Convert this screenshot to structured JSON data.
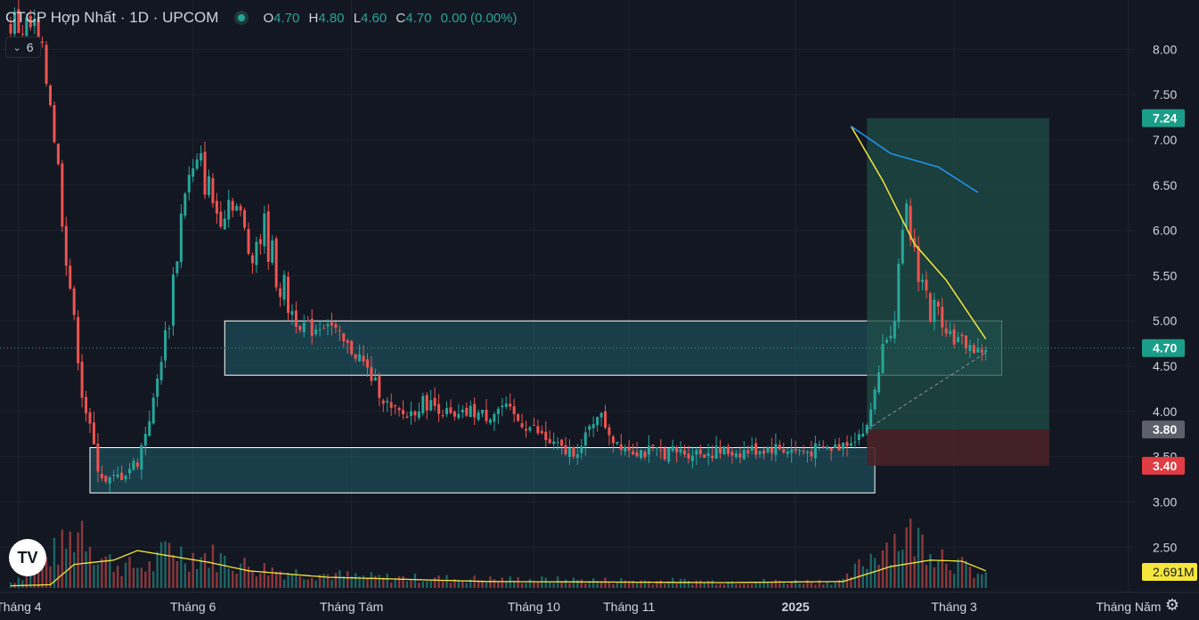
{
  "header": {
    "title": "CTCP Hợp Nhất · 1D · UPCOM",
    "ohlc": [
      {
        "key": "O",
        "value": "4.70"
      },
      {
        "key": "H",
        "value": "4.80"
      },
      {
        "key": "L",
        "value": "4.60"
      },
      {
        "key": "C",
        "value": "4.70"
      }
    ],
    "change": "0.00 (0.00%)",
    "indicator_count": "6",
    "status_icon": "market-open-dot-icon",
    "collapse_icon": "chevron-down-icon",
    "logo_text": "TV",
    "settings_icon": "gear-icon"
  },
  "colors": {
    "background": "#131722",
    "up": "#26a69a",
    "down": "#ef5350",
    "ma_fast": "#f5e63b",
    "ma_slow": "#2196f3",
    "zone_fill": "#1f5f6b",
    "target_fill": "#1f4d45",
    "stop_fill": "#4a2228"
  },
  "chart_data": {
    "type": "candlestick",
    "title": "CTCP Hợp Nhất · 1D · UPCOM",
    "y_ticks": [
      "8.00",
      "7.50",
      "7.00",
      "6.50",
      "6.00",
      "5.50",
      "5.00",
      "4.50",
      "4.00",
      "3.50",
      "3.00",
      "2.50"
    ],
    "y_range": [
      2.05,
      8.25
    ],
    "x_ticks": [
      "Tháng 4",
      "Tháng 6",
      "Tháng Tám",
      "Tháng 10",
      "Tháng 11",
      "2025",
      "Tháng 3",
      "Tháng Năm"
    ],
    "x_ticks_bold": [
      "2025"
    ],
    "candle_keypoints": [
      [
        0,
        8.3,
        "open"
      ],
      [
        6,
        8.2
      ],
      [
        10,
        7.5
      ],
      [
        14,
        5.8
      ],
      [
        18,
        4.2
      ],
      [
        22,
        3.4
      ],
      [
        24,
        3.2
      ],
      [
        28,
        3.3
      ],
      [
        32,
        3.45
      ],
      [
        36,
        4.1
      ],
      [
        40,
        5.1
      ],
      [
        44,
        6.5
      ],
      [
        48,
        6.7
      ],
      [
        52,
        6.2
      ],
      [
        56,
        6.4
      ],
      [
        60,
        5.8
      ],
      [
        64,
        6.0
      ],
      [
        68,
        5.4
      ],
      [
        72,
        5.0
      ],
      [
        76,
        4.9
      ],
      [
        80,
        5.0
      ],
      [
        84,
        4.75
      ],
      [
        88,
        4.6
      ],
      [
        92,
        4.3
      ],
      [
        96,
        4.0
      ],
      [
        100,
        3.95
      ],
      [
        104,
        4.1
      ],
      [
        108,
        4.05
      ],
      [
        112,
        3.9
      ],
      [
        116,
        4.0
      ],
      [
        120,
        3.95
      ],
      [
        124,
        4.05
      ],
      [
        128,
        3.9
      ],
      [
        132,
        3.8
      ],
      [
        136,
        3.65
      ],
      [
        140,
        3.55
      ],
      [
        144,
        3.6
      ],
      [
        148,
        4.0
      ],
      [
        152,
        3.7
      ],
      [
        156,
        3.6
      ],
      [
        160,
        3.55
      ],
      [
        168,
        3.55
      ],
      [
        176,
        3.55
      ],
      [
        184,
        3.55
      ],
      [
        192,
        3.6
      ],
      [
        200,
        3.55
      ],
      [
        208,
        3.6
      ],
      [
        212,
        3.7
      ],
      [
        216,
        3.8
      ],
      [
        220,
        4.7
      ],
      [
        223,
        5.2
      ],
      [
        226,
        6.1
      ],
      [
        229,
        5.6
      ],
      [
        232,
        5.1
      ],
      [
        235,
        5.0
      ],
      [
        238,
        4.8
      ],
      [
        241,
        4.75
      ],
      [
        244,
        4.65
      ],
      [
        246,
        4.7
      ]
    ],
    "ma_fast_line": [
      [
        212,
        7.15
      ],
      [
        220,
        6.55
      ],
      [
        228,
        5.85
      ],
      [
        236,
        5.45
      ],
      [
        246,
        4.8
      ]
    ],
    "ma_slow_line": [
      [
        212,
        7.15
      ],
      [
        222,
        6.85
      ],
      [
        234,
        6.7
      ],
      [
        244,
        6.42
      ]
    ],
    "trend_line": {
      "from": [
        216,
        3.8
      ],
      "to": [
        246,
        4.65
      ],
      "style": "dashed"
    },
    "zones": [
      {
        "name": "upper-zone",
        "from_index": 54,
        "to_index": 250,
        "low": 4.4,
        "high": 5.0
      },
      {
        "name": "lower-zone",
        "from_index": 20,
        "to_index": 218,
        "low": 3.1,
        "high": 3.6
      }
    ],
    "long_position": {
      "from_index": 216,
      "to_index": 262,
      "entry": 3.8,
      "target": 7.24,
      "stop": 3.4
    },
    "price_labels": [
      {
        "value": 7.24,
        "text": "7.24",
        "color": "#1b9e89"
      },
      {
        "value": 4.7,
        "text": "4.70",
        "color": "#1b9e89"
      },
      {
        "value": 3.8,
        "text": "3.80",
        "color": "#5d606b"
      },
      {
        "value": 3.4,
        "text": "3.40",
        "color": "#e13b43"
      }
    ],
    "volume_ma_label": {
      "text": "2.691M",
      "color": "#f5e63b"
    },
    "volume_keypoints": [
      [
        0,
        0.5
      ],
      [
        14,
        4
      ],
      [
        18,
        6
      ],
      [
        22,
        3
      ],
      [
        28,
        2
      ],
      [
        36,
        2
      ],
      [
        40,
        4
      ],
      [
        44,
        3
      ],
      [
        50,
        3
      ],
      [
        60,
        2
      ],
      [
        70,
        1.5
      ],
      [
        90,
        1
      ],
      [
        120,
        0.8
      ],
      [
        150,
        0.7
      ],
      [
        180,
        0.6
      ],
      [
        210,
        0.6
      ],
      [
        220,
        4
      ],
      [
        226,
        5
      ],
      [
        232,
        4
      ],
      [
        240,
        2
      ],
      [
        246,
        1
      ]
    ],
    "volume_ma_keypoints": [
      [
        0,
        0.2
      ],
      [
        10,
        0.3
      ],
      [
        16,
        2.2
      ],
      [
        26,
        2.6
      ],
      [
        32,
        3.5
      ],
      [
        40,
        3.0
      ],
      [
        50,
        2.4
      ],
      [
        60,
        1.6
      ],
      [
        80,
        1.0
      ],
      [
        120,
        0.6
      ],
      [
        180,
        0.5
      ],
      [
        210,
        0.6
      ],
      [
        222,
        2.0
      ],
      [
        232,
        2.6
      ],
      [
        240,
        2.5
      ],
      [
        246,
        1.6
      ]
    ]
  }
}
